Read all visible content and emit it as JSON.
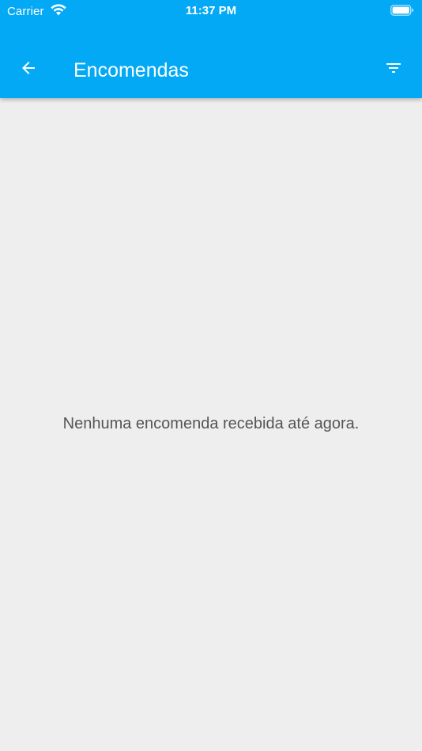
{
  "status_bar": {
    "carrier": "Carrier",
    "time": "11:37 PM",
    "wifi_icon": "wifi-icon",
    "battery_icon": "battery-icon"
  },
  "toolbar": {
    "title": "Encomendas",
    "back_icon": "arrow-left-icon",
    "filter_icon": "filter-icon"
  },
  "content": {
    "empty_message": "Nenhuma encomenda recebida até agora."
  },
  "colors": {
    "primary": "#03a9f4",
    "background": "#eeeeee",
    "text_secondary": "#555555",
    "on_primary": "#ffffff"
  }
}
